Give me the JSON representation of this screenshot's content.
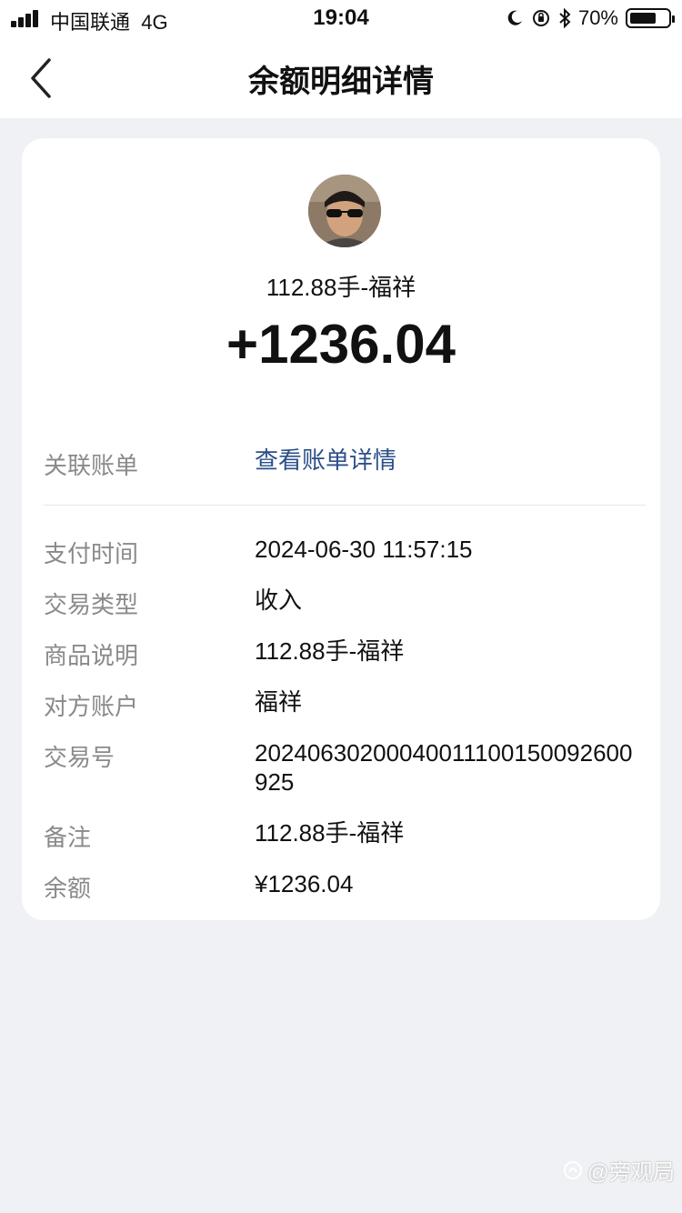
{
  "status_bar": {
    "carrier": "中国联通",
    "network": "4G",
    "time": "19:04",
    "battery_percent": "70%",
    "battery_level": 0.7,
    "icons": [
      "moon-icon",
      "orientation-lock-icon",
      "bluetooth-icon",
      "battery-icon"
    ]
  },
  "nav": {
    "title": "余额明细详情",
    "back_icon": "chevron-left-icon"
  },
  "card": {
    "avatar_icon": "avatar",
    "merchant": "112.88手-福祥",
    "amount": "+1236.04",
    "linked_bill": {
      "label": "关联账单",
      "value": "查看账单详情"
    },
    "details": [
      {
        "label": "支付时间",
        "value": "2024-06-30 11:57:15"
      },
      {
        "label": "交易类型",
        "value": "收入"
      },
      {
        "label": "商品说明",
        "value": "112.88手-福祥"
      },
      {
        "label": "对方账户",
        "value": "福祥"
      },
      {
        "label": "交易号",
        "value": "20240630200040011100150092600925"
      },
      {
        "label": "备注",
        "value": "112.88手-福祥"
      },
      {
        "label": "余额",
        "value": "¥1236.04"
      }
    ]
  },
  "watermark": "@旁观局"
}
